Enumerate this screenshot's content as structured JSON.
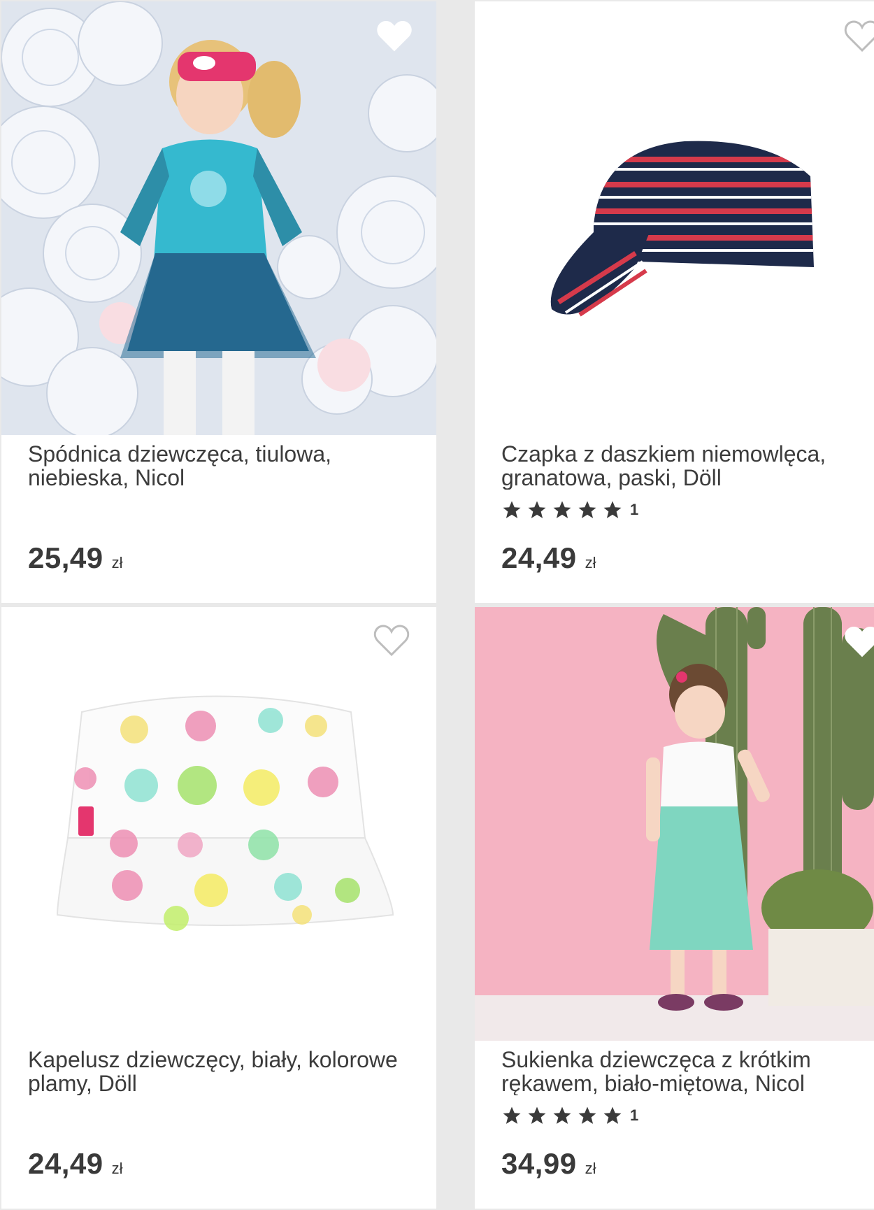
{
  "products": [
    {
      "title": "Spódnica dziewczęca, tiulowa, niebieska, Nicol",
      "price": "25,49",
      "currency": "zł",
      "favorite_icon": "heart-outline-icon",
      "image": "girl-in-blue-tulle-skirt-photo"
    },
    {
      "title": "Czapka z daszkiem niemowlęca, granatowa, paski, Döll",
      "price": "24,49",
      "currency": "zł",
      "rating_stars": 5,
      "rating_count": "1",
      "favorite_icon": "heart-outline-icon",
      "image": "striped-baby-cap-photo"
    },
    {
      "title": "Kapelusz dziewczęcy, biały, kolorowe plamy, Döll",
      "price": "24,49",
      "currency": "zł",
      "favorite_icon": "heart-outline-icon",
      "image": "white-spotted-bucket-hat-photo"
    },
    {
      "title": "Sukienka dziewczęca z krótkim rękawem, biało-miętowa, Nicol",
      "price": "34,99",
      "currency": "zł",
      "rating_stars": 5,
      "rating_count": "1",
      "favorite_icon": "heart-outline-icon",
      "image": "girl-in-mint-dress-with-cactus-photo"
    }
  ],
  "colors": {
    "background": "#e9e9e9",
    "card": "#ffffff",
    "text": "#3a3a3a",
    "star": "#3a3a3a"
  }
}
